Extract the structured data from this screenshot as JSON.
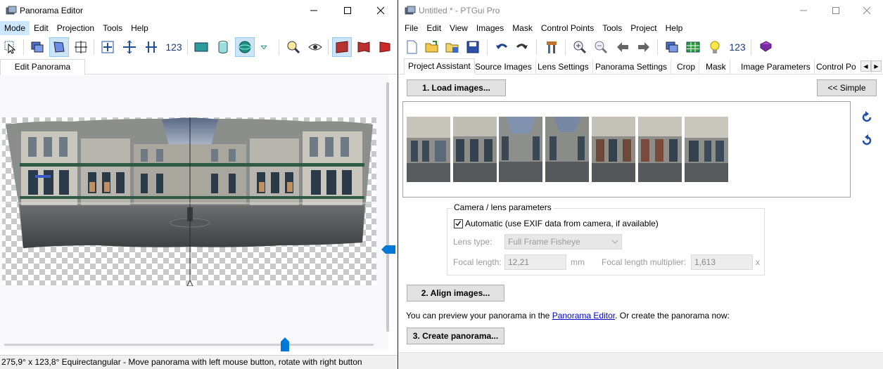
{
  "panorama_editor": {
    "title": "Panorama Editor",
    "menu": [
      "Mode",
      "Edit",
      "Projection",
      "Tools",
      "Help"
    ],
    "toolbar_text": "123",
    "tab": "Edit Panorama",
    "status": "275,9° x 123,8° Equirectangular - Move panorama with left mouse button, rotate with right button"
  },
  "ptgui": {
    "title": "Untitled * - PTGui Pro",
    "menu": [
      "File",
      "Edit",
      "View",
      "Images",
      "Mask",
      "Control Points",
      "Tools",
      "Project",
      "Help"
    ],
    "toolbar_text": "123",
    "tabs": [
      "Project Assistant",
      "Source Images",
      "Lens Settings",
      "Panorama Settings",
      "Crop",
      "Mask",
      "Image Parameters",
      "Control Po"
    ],
    "load_images_button": "1. Load images...",
    "simple_button": "<< Simple",
    "image_count": 7,
    "camera_group": {
      "legend": "Camera / lens parameters",
      "automatic_checked": true,
      "automatic_label": "Automatic (use EXIF data from camera, if available)",
      "lens_type_label": "Lens type:",
      "lens_type_value": "Full Frame Fisheye",
      "focal_length_label": "Focal length:",
      "focal_length_value": "12,21",
      "focal_length_unit": "mm",
      "multiplier_label": "Focal length multiplier:",
      "multiplier_value": "1,613",
      "multiplier_unit": "x"
    },
    "align_button": "2. Align images...",
    "preview_text_before": "You can preview your panorama in the ",
    "preview_link": "Panorama Editor",
    "preview_text_after": ". Or create the panorama now:",
    "create_button": "3. Create panorama..."
  }
}
